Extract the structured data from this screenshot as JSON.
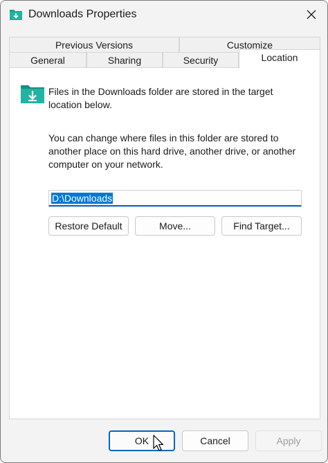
{
  "window": {
    "title": "Downloads Properties"
  },
  "tabs": {
    "row1": [
      {
        "label": "Previous Versions"
      },
      {
        "label": "Customize"
      }
    ],
    "row2": [
      {
        "label": "General"
      },
      {
        "label": "Sharing"
      },
      {
        "label": "Security"
      },
      {
        "label": "Location",
        "active": true
      }
    ]
  },
  "location": {
    "description": "Files in the Downloads folder are stored in the target location below.",
    "info": "You can change where files in this folder are stored to another place on this hard drive, another drive, or another computer on your network.",
    "path_value": "D:\\Downloads",
    "restore_default_label": "Restore Default",
    "move_label": "Move...",
    "find_target_label": "Find Target..."
  },
  "footer": {
    "ok_label": "OK",
    "cancel_label": "Cancel",
    "apply_label": "Apply",
    "apply_enabled": false
  },
  "colors": {
    "accent": "#0078d4",
    "folder": "#1a9e8f"
  },
  "icons": {
    "title": "downloads-folder-icon",
    "close": "close-icon",
    "panel": "downloads-folder-icon",
    "pointer": "mouse-pointer-icon"
  }
}
